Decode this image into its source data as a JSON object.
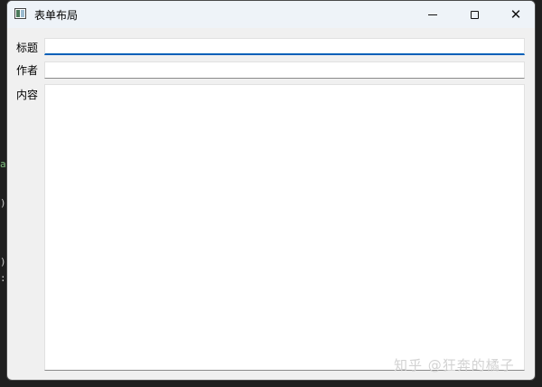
{
  "window": {
    "title": "表单布局",
    "icon": "window-app-icon"
  },
  "titlebar_buttons": {
    "minimize": "minimize-icon",
    "maximize": "maximize-icon",
    "close": "close-icon",
    "close_glyph": "✕"
  },
  "form": {
    "title_label": "标题",
    "title_value": "",
    "author_label": "作者",
    "author_value": "",
    "content_label": "内容",
    "content_value": ""
  },
  "watermark": "知乎 @狂奔的橘子",
  "background_residue": {
    "glyph_1": "a",
    "glyph_2": ")",
    "glyph_3": ")",
    "glyph_4": ":"
  },
  "colors": {
    "focus_accent": "#005fb8",
    "window_bg": "#f0f0f0",
    "titlebar_bg": "#eef3f8"
  }
}
